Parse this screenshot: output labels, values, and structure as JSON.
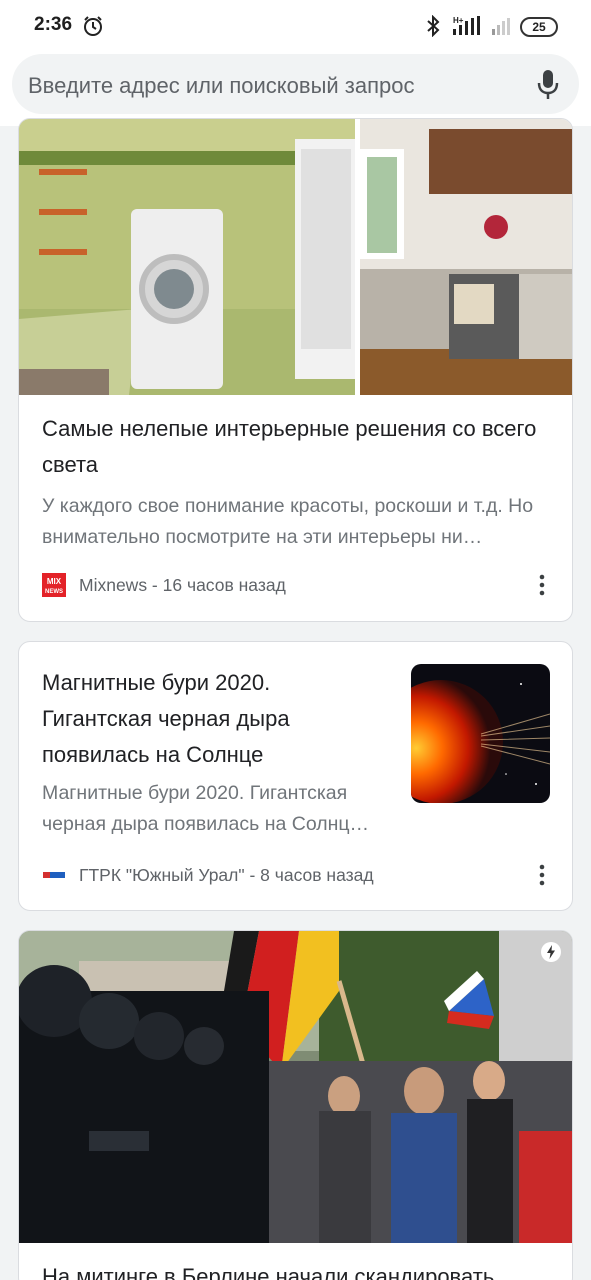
{
  "status_bar": {
    "time": "2:36",
    "battery": "25",
    "icons": [
      "alarm-icon",
      "bluetooth-icon",
      "signal-hplus-icon",
      "signal-weak-icon",
      "battery-icon"
    ]
  },
  "address_bar": {
    "placeholder": "Введите адрес или поисковый запрос",
    "icon": "mic-icon"
  },
  "feed": {
    "cards": [
      {
        "title": "Самые нелепые интерьерные решения со всего света",
        "description": "У каждого свое понимание красоты, роскоши и т.д. Но внимательно посмотрите на эти интерьеры ни…",
        "source": "Mixnews - 16 часов назад",
        "logo_text": "MIX NEWS"
      },
      {
        "title": "Магнитные бури 2020. Гигантская черная дыра появилась на Солнце",
        "description": "Магнитные бури 2020. Гигантская черная дыра появилась на Солнц…",
        "source": "ГТРК \"Южный Урал\" - 8 часов назад"
      },
      {
        "title": "На митинге в Берлине начали скандировать"
      }
    ]
  },
  "colors": {
    "background": "#f1f3f4",
    "card": "#ffffff",
    "title": "#202124",
    "description": "#70757a",
    "mixnews_red": "#e32228"
  }
}
